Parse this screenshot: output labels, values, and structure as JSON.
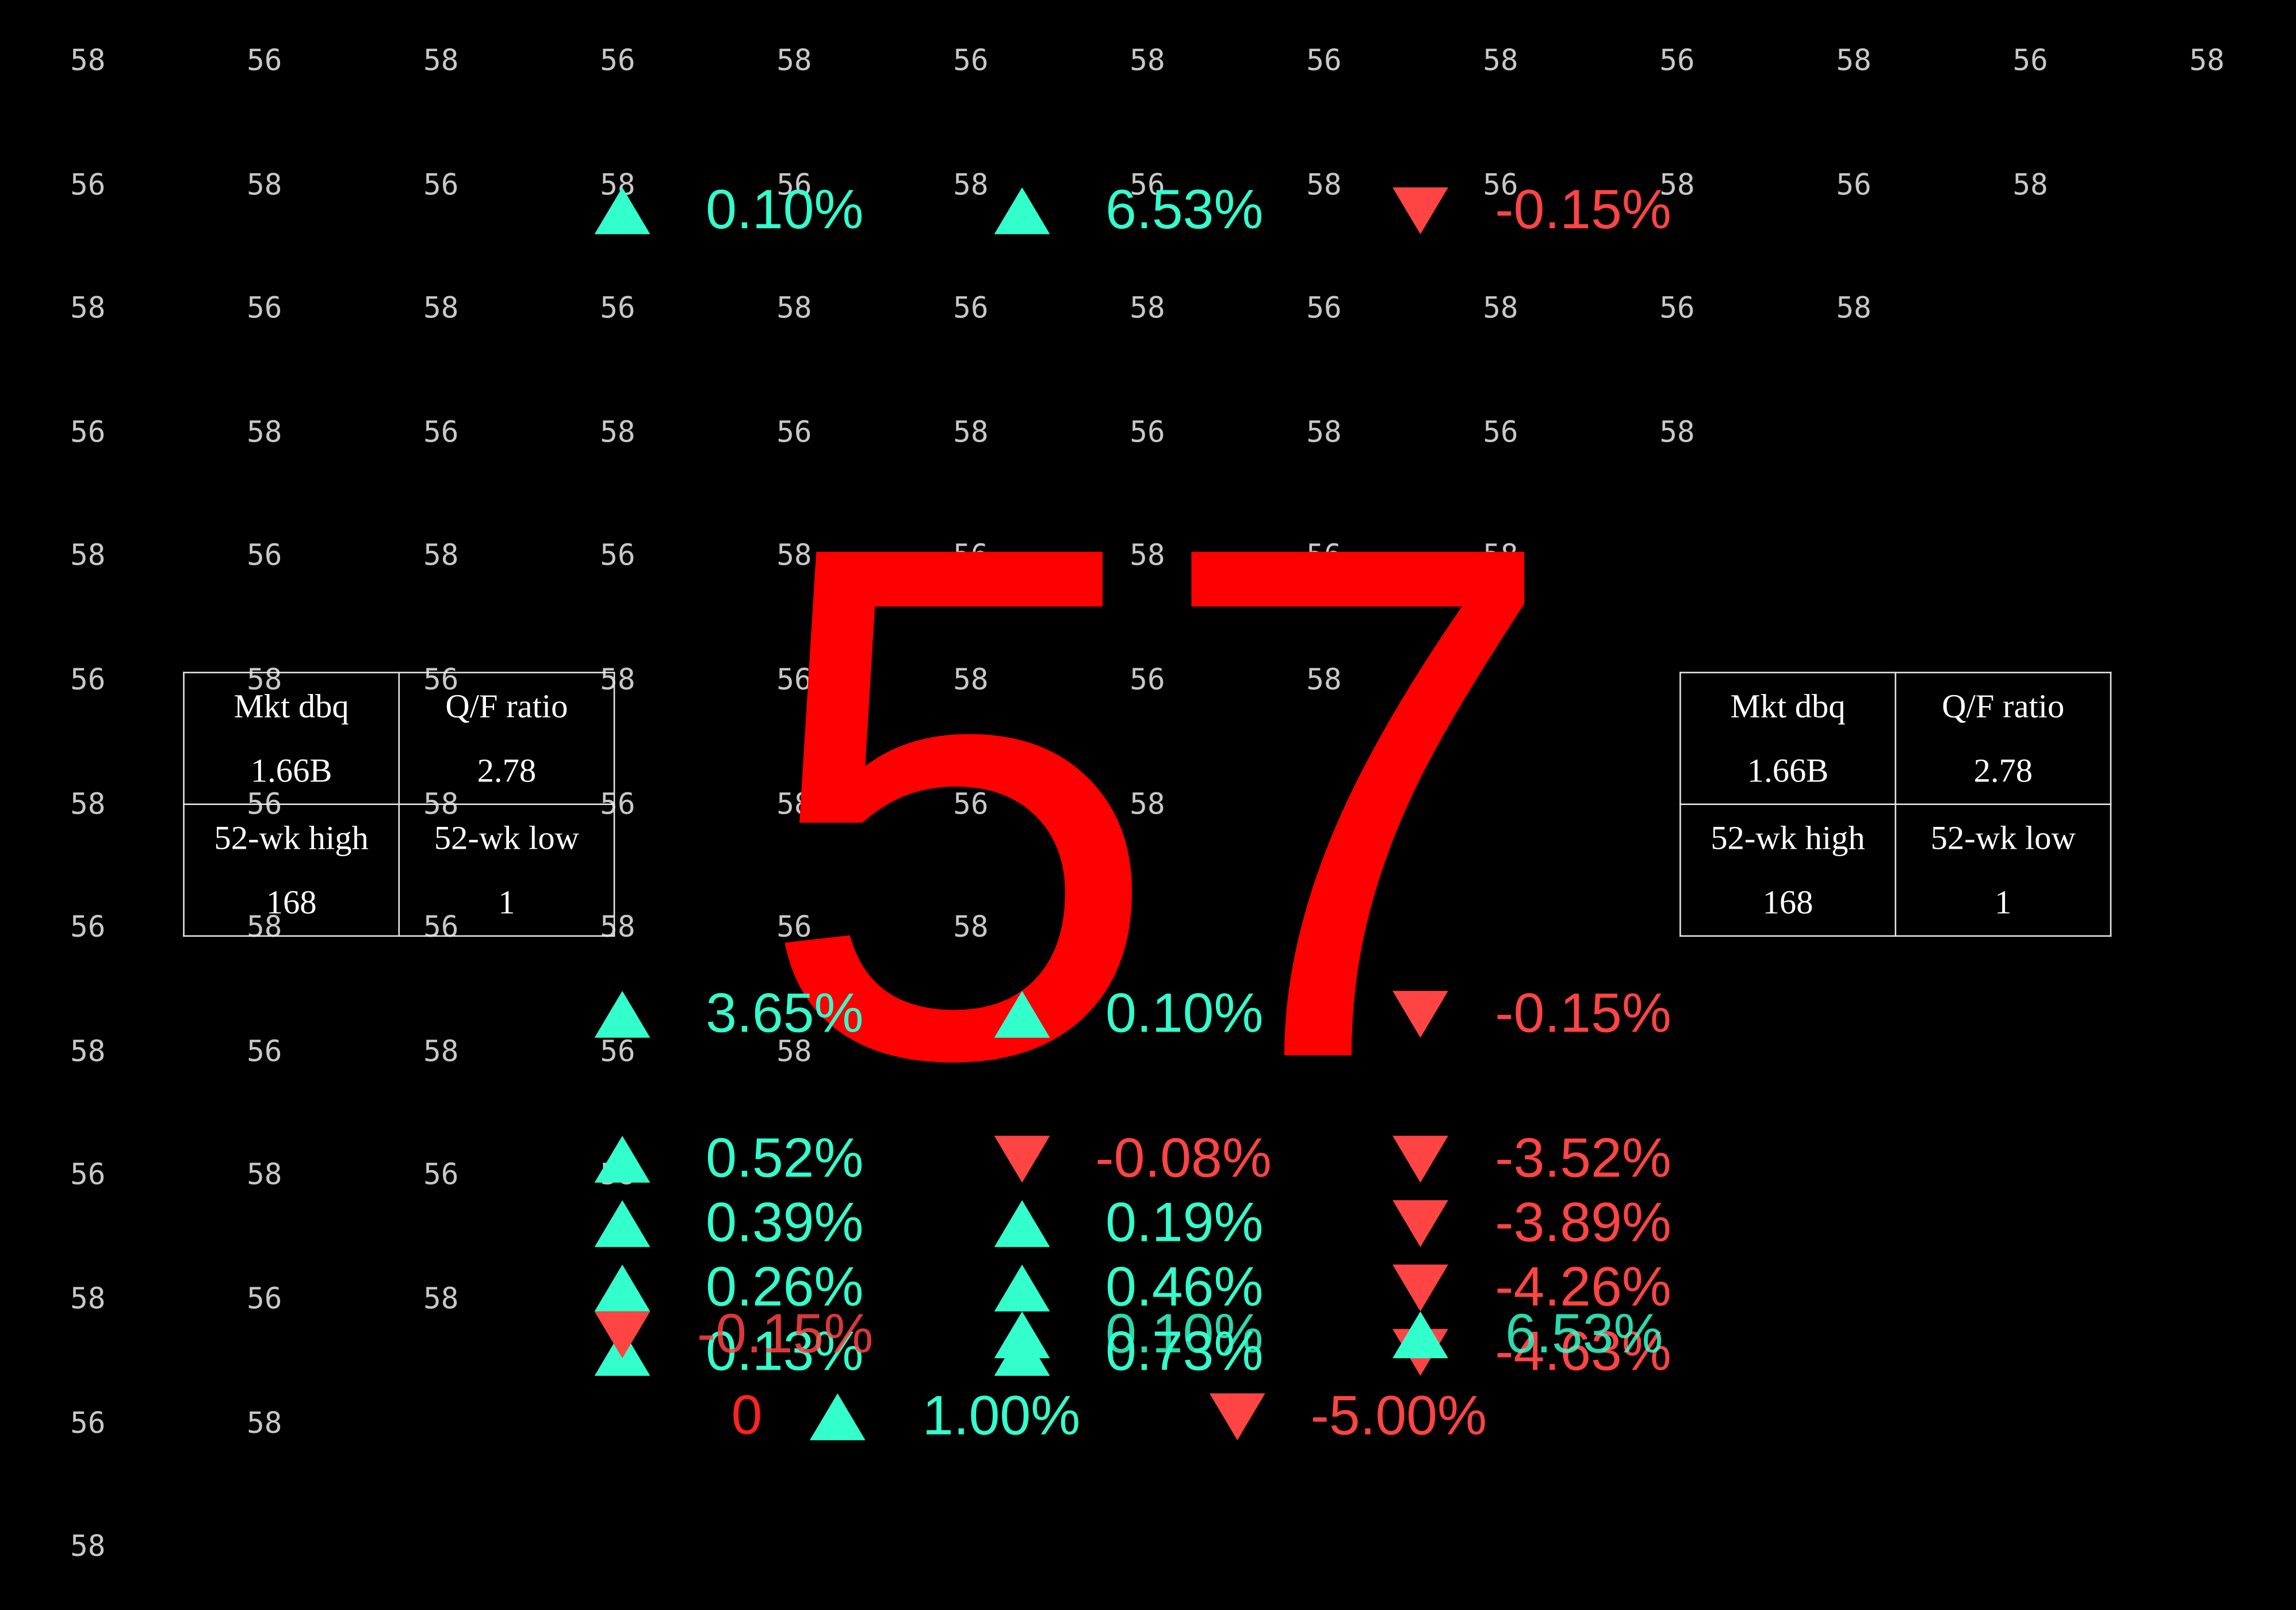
{
  "colors": {
    "background": "#000000",
    "up": "#33ffcc",
    "down": "#ff4444",
    "hero": "#ff0000",
    "grid": "#c8c8c8"
  },
  "grid_rows": [
    [
      "58",
      "56",
      "58",
      "56",
      "58",
      "56",
      "58",
      "56",
      "58",
      "56",
      "58",
      "56",
      "58"
    ],
    [
      "56",
      "58",
      "56",
      "58",
      "56",
      "58",
      "56",
      "58",
      "56",
      "58",
      "56",
      "58"
    ],
    [
      "58",
      "56",
      "58",
      "56",
      "58",
      "56",
      "58",
      "56",
      "58",
      "56",
      "58"
    ],
    [
      "56",
      "58",
      "56",
      "58",
      "56",
      "58",
      "56",
      "58",
      "56",
      "58"
    ],
    [
      "58",
      "56",
      "58",
      "56",
      "58",
      "56",
      "58",
      "56",
      "58"
    ],
    [
      "56",
      "58",
      "56",
      "58",
      "56",
      "58",
      "56",
      "58"
    ],
    [
      "58",
      "56",
      "58",
      "56",
      "58",
      "56",
      "58"
    ],
    [
      "56",
      "58",
      "56",
      "58",
      "56",
      "58"
    ],
    [
      "58",
      "56",
      "58",
      "56",
      "58"
    ],
    [
      "56",
      "58",
      "56",
      "58"
    ],
    [
      "58",
      "56",
      "58"
    ],
    [
      "56",
      "58"
    ],
    [
      "58"
    ]
  ],
  "hero_value": "57",
  "tickers": {
    "top_row": [
      {
        "dir": "up",
        "value": "0.10%"
      },
      {
        "dir": "up",
        "value": "6.53%"
      },
      {
        "dir": "down",
        "value": "-0.15%"
      }
    ],
    "mid_row": [
      {
        "dir": "up",
        "value": "3.65%"
      },
      {
        "dir": "up",
        "value": "0.10%"
      },
      {
        "dir": "down",
        "value": "-0.15%"
      }
    ],
    "stack_rows": [
      [
        {
          "dir": "up",
          "value": "0.52%"
        },
        {
          "dir": "down",
          "value": "-0.08%"
        },
        {
          "dir": "down",
          "value": "-3.52%"
        }
      ],
      [
        {
          "dir": "up",
          "value": "0.39%"
        },
        {
          "dir": "up",
          "value": "0.19%"
        },
        {
          "dir": "down",
          "value": "-3.89%"
        }
      ],
      [
        {
          "dir": "up",
          "value": "0.26%"
        },
        {
          "dir": "up",
          "value": "0.46%"
        },
        {
          "dir": "down",
          "value": "-4.26%"
        }
      ],
      [
        {
          "dir": "up",
          "value": "0.13%"
        },
        {
          "dir": "up",
          "value": "0.73%"
        },
        {
          "dir": "down",
          "value": "-4.63%"
        }
      ]
    ],
    "overlap_row": [
      {
        "dir": "down",
        "value": "-0.15%"
      },
      {
        "dir": "up",
        "value": "0.10%"
      },
      {
        "dir": "up",
        "value": "6.53%"
      }
    ],
    "bottom_row": {
      "zero": "0",
      "items": [
        {
          "dir": "up",
          "value": "1.00%"
        },
        {
          "dir": "down",
          "value": "-5.00%"
        }
      ]
    }
  },
  "stats_left": {
    "mkt_label": "Mkt dbq",
    "mkt_value": "1.66B",
    "qf_label": "Q/F ratio",
    "qf_value": "2.78",
    "high_label": "52-wk high",
    "high_value": "168",
    "low_label": "52-wk low",
    "low_value": "1"
  },
  "stats_right": {
    "mkt_label": "Mkt dbq",
    "mkt_value": "1.66B",
    "qf_label": "Q/F ratio",
    "qf_value": "2.78",
    "high_label": "52-wk high",
    "high_value": "168",
    "low_label": "52-wk low",
    "low_value": "1"
  }
}
